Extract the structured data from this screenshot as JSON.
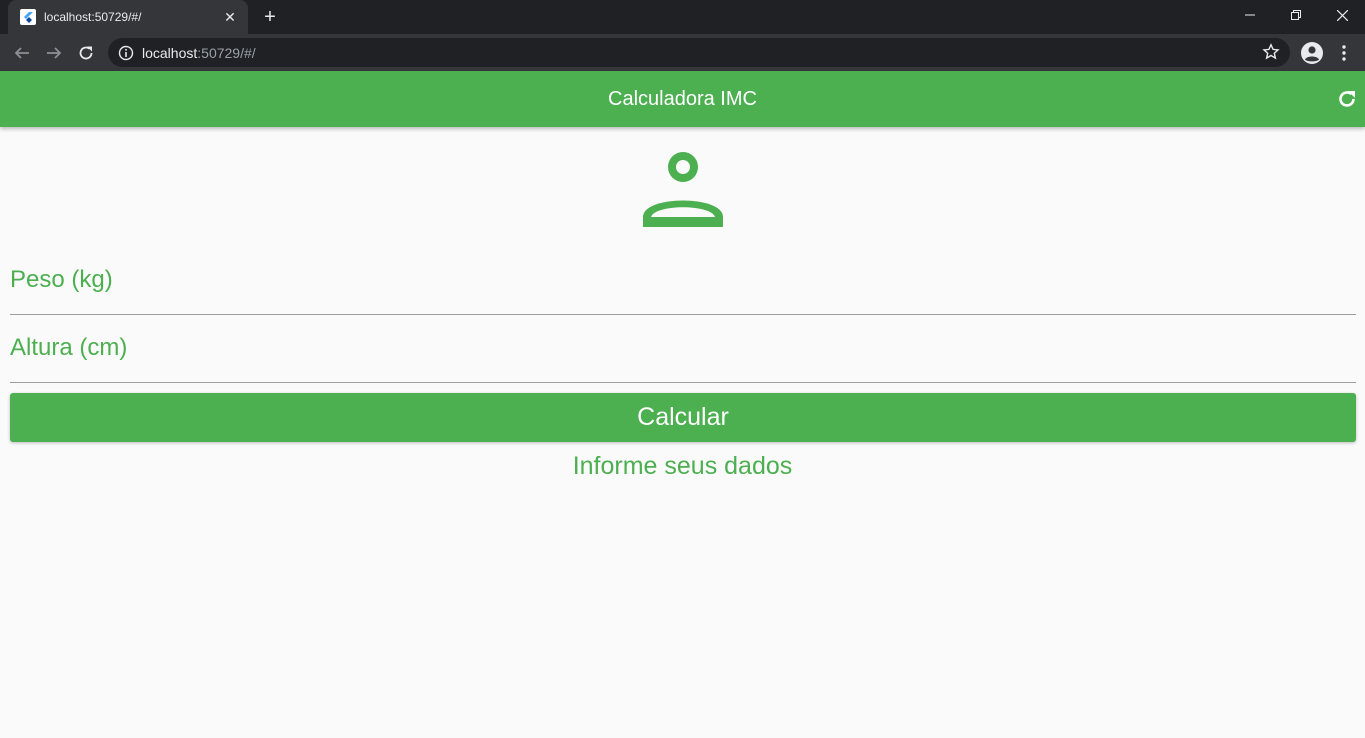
{
  "browser": {
    "tab_title": "localhost:50729/#/",
    "url_host": "localhost",
    "url_rest": ":50729/#/"
  },
  "app": {
    "title": "Calculadora IMC",
    "accent_color": "#4caf50",
    "header_icon": "person-outline-icon",
    "weight_label": "Peso (kg)",
    "height_label": "Altura (cm)",
    "calculate_label": "Calcular",
    "info_text": "Informe seus dados"
  }
}
